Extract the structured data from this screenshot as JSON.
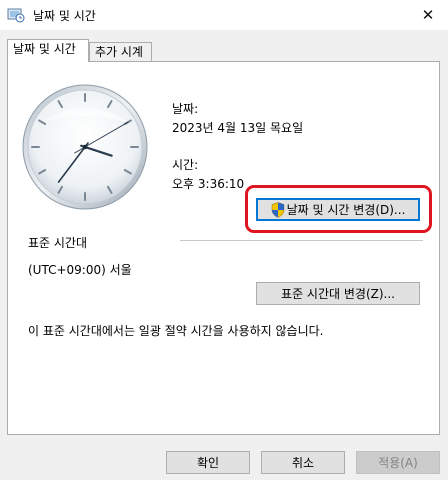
{
  "window": {
    "title": "날짜 및 시간",
    "close_glyph": "✕"
  },
  "tabs": [
    {
      "label": "날짜 및 시간",
      "active": true
    },
    {
      "label": "추가 시계",
      "active": false
    }
  ],
  "datetime": {
    "date_label": "날짜:",
    "date_value": "2023년 4월 13일 목요일",
    "time_label": "시간:",
    "time_value": "오후 3:36:10",
    "change_button": "날짜 및 시간 변경(D)..."
  },
  "timezone": {
    "heading": "표준 시간대",
    "value": "(UTC+09:00) 서울",
    "change_button": "표준 시간대 변경(Z)...",
    "dst_note": "이 표준 시간대에서는 일광 절약 시간을 사용하지 않습니다."
  },
  "footer": {
    "ok": "확인",
    "cancel": "취소",
    "apply": "적용(A)"
  },
  "clock": {
    "hours": 3,
    "minutes": 36,
    "seconds": 10
  },
  "colors": {
    "accent": "#0078d7",
    "highlight": "#e0141e",
    "clock_hand": "#2a3b4c"
  },
  "icons": {
    "title": "datetime-settings-icon",
    "shield": "uac-shield-icon"
  }
}
